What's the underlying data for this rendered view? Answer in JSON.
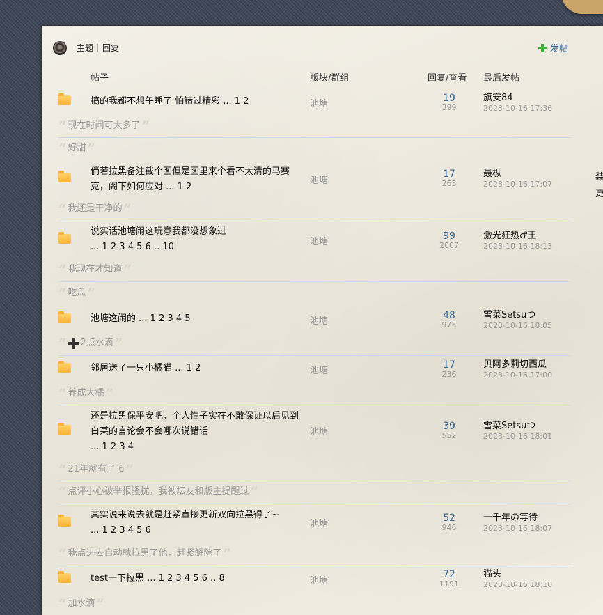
{
  "toolbar": {
    "topic_label": "主题",
    "reply_label": "回复",
    "post_label": "发帖"
  },
  "headers": {
    "post": "帖子",
    "board": "版块/群组",
    "stats": "回复/查看",
    "last": "最后发帖"
  },
  "threads": [
    {
      "title": "搞的我都不想午睡了 怕错过精彩",
      "pages": "... 1 2",
      "board": "池塘",
      "replies": "19",
      "views": "399",
      "last_user": "旗安84",
      "last_time": "2023-10-16 17:36"
    },
    {
      "title": "倘若拉黑备注截个图但是图里来个看不太清的马赛克，阁下如何应对",
      "pages": "... 1 2",
      "board": "池塘",
      "replies": "17",
      "views": "263",
      "last_user": "聂枞",
      "last_time": "2023-10-16 17:07"
    },
    {
      "title": "说实话池塘闹这玩意我都没想象过",
      "pages": "... 1 2 3 4 5 6 .. 10",
      "board": "池塘",
      "replies": "99",
      "views": "2007",
      "last_user": "激光狂热♂王",
      "last_time": "2023-10-16 18:13"
    },
    {
      "title": "池塘这闹的",
      "pages": "... 1 2 3 4 5",
      "board": "池塘",
      "replies": "48",
      "views": "975",
      "last_user": "雪菜Setsuつ",
      "last_time": "2023-10-16 18:05"
    },
    {
      "title": "邻居送了一只小橘猫",
      "pages": "... 1 2",
      "board": "池塘",
      "replies": "17",
      "views": "236",
      "last_user": "贝阿多莉切西瓜",
      "last_time": "2023-10-16 17:00"
    },
    {
      "title": "还是拉黑保平安吧，个人性子实在不敢保证以后见到白某的言论会不会哪次说错话",
      "pages": "... 1 2 3 4",
      "board": "池塘",
      "replies": "39",
      "views": "552",
      "last_user": "雪菜Setsuつ",
      "last_time": "2023-10-16 18:01"
    },
    {
      "title": "其实说来说去就是赶紧直接更新双向拉黑得了~",
      "pages": "... 1 2 3 4 5 6",
      "board": "池塘",
      "replies": "52",
      "views": "946",
      "last_user": "一千年の等待",
      "last_time": "2023-10-16 18:07"
    },
    {
      "title": "test一下拉黑",
      "pages": "... 1 2 3 4 5 6 .. 8",
      "board": "池塘",
      "replies": "72",
      "views": "1191",
      "last_user": "猫头",
      "last_time": "2023-10-16 18:10"
    }
  ],
  "comments": [
    "现在时间可太多了",
    "好甜",
    "我还是干净的",
    "我现在才知道",
    "吃瓜",
    "2点水滴",
    "养成大橘",
    "21年就有了 6",
    "点评小心被举报骚扰，我被坛友和版主提醒过",
    "我点进去自动就拉黑了他，赶紧解除了",
    "加水滴"
  ],
  "side": {
    "line1": "装",
    "line2": "更"
  }
}
